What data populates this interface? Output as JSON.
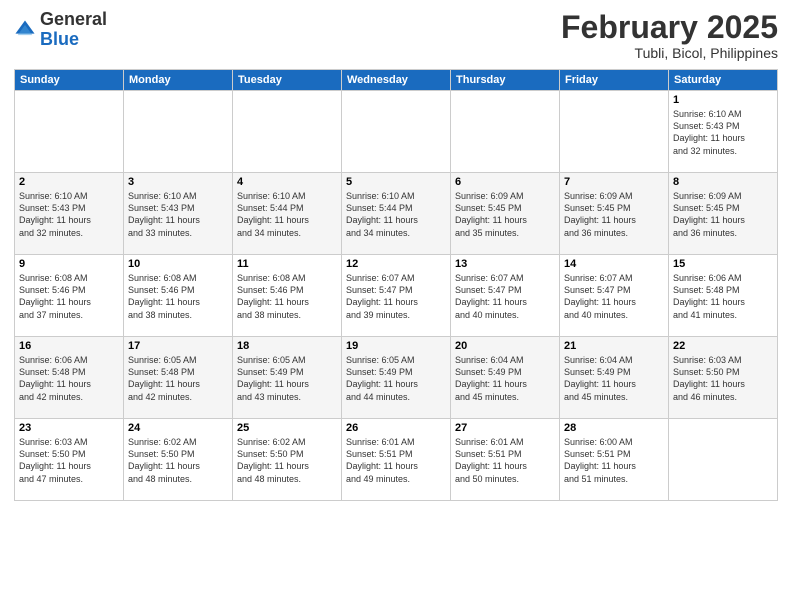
{
  "logo": {
    "general": "General",
    "blue": "Blue"
  },
  "title": {
    "month": "February 2025",
    "location": "Tubli, Bicol, Philippines"
  },
  "days_of_week": [
    "Sunday",
    "Monday",
    "Tuesday",
    "Wednesday",
    "Thursday",
    "Friday",
    "Saturday"
  ],
  "weeks": [
    [
      {
        "day": "",
        "info": ""
      },
      {
        "day": "",
        "info": ""
      },
      {
        "day": "",
        "info": ""
      },
      {
        "day": "",
        "info": ""
      },
      {
        "day": "",
        "info": ""
      },
      {
        "day": "",
        "info": ""
      },
      {
        "day": "1",
        "info": "Sunrise: 6:10 AM\nSunset: 5:43 PM\nDaylight: 11 hours\nand 32 minutes."
      }
    ],
    [
      {
        "day": "2",
        "info": "Sunrise: 6:10 AM\nSunset: 5:43 PM\nDaylight: 11 hours\nand 32 minutes."
      },
      {
        "day": "3",
        "info": "Sunrise: 6:10 AM\nSunset: 5:43 PM\nDaylight: 11 hours\nand 33 minutes."
      },
      {
        "day": "4",
        "info": "Sunrise: 6:10 AM\nSunset: 5:44 PM\nDaylight: 11 hours\nand 34 minutes."
      },
      {
        "day": "5",
        "info": "Sunrise: 6:10 AM\nSunset: 5:44 PM\nDaylight: 11 hours\nand 34 minutes."
      },
      {
        "day": "6",
        "info": "Sunrise: 6:09 AM\nSunset: 5:45 PM\nDaylight: 11 hours\nand 35 minutes."
      },
      {
        "day": "7",
        "info": "Sunrise: 6:09 AM\nSunset: 5:45 PM\nDaylight: 11 hours\nand 36 minutes."
      },
      {
        "day": "8",
        "info": "Sunrise: 6:09 AM\nSunset: 5:45 PM\nDaylight: 11 hours\nand 36 minutes."
      }
    ],
    [
      {
        "day": "9",
        "info": "Sunrise: 6:08 AM\nSunset: 5:46 PM\nDaylight: 11 hours\nand 37 minutes."
      },
      {
        "day": "10",
        "info": "Sunrise: 6:08 AM\nSunset: 5:46 PM\nDaylight: 11 hours\nand 38 minutes."
      },
      {
        "day": "11",
        "info": "Sunrise: 6:08 AM\nSunset: 5:46 PM\nDaylight: 11 hours\nand 38 minutes."
      },
      {
        "day": "12",
        "info": "Sunrise: 6:07 AM\nSunset: 5:47 PM\nDaylight: 11 hours\nand 39 minutes."
      },
      {
        "day": "13",
        "info": "Sunrise: 6:07 AM\nSunset: 5:47 PM\nDaylight: 11 hours\nand 40 minutes."
      },
      {
        "day": "14",
        "info": "Sunrise: 6:07 AM\nSunset: 5:47 PM\nDaylight: 11 hours\nand 40 minutes."
      },
      {
        "day": "15",
        "info": "Sunrise: 6:06 AM\nSunset: 5:48 PM\nDaylight: 11 hours\nand 41 minutes."
      }
    ],
    [
      {
        "day": "16",
        "info": "Sunrise: 6:06 AM\nSunset: 5:48 PM\nDaylight: 11 hours\nand 42 minutes."
      },
      {
        "day": "17",
        "info": "Sunrise: 6:05 AM\nSunset: 5:48 PM\nDaylight: 11 hours\nand 42 minutes."
      },
      {
        "day": "18",
        "info": "Sunrise: 6:05 AM\nSunset: 5:49 PM\nDaylight: 11 hours\nand 43 minutes."
      },
      {
        "day": "19",
        "info": "Sunrise: 6:05 AM\nSunset: 5:49 PM\nDaylight: 11 hours\nand 44 minutes."
      },
      {
        "day": "20",
        "info": "Sunrise: 6:04 AM\nSunset: 5:49 PM\nDaylight: 11 hours\nand 45 minutes."
      },
      {
        "day": "21",
        "info": "Sunrise: 6:04 AM\nSunset: 5:49 PM\nDaylight: 11 hours\nand 45 minutes."
      },
      {
        "day": "22",
        "info": "Sunrise: 6:03 AM\nSunset: 5:50 PM\nDaylight: 11 hours\nand 46 minutes."
      }
    ],
    [
      {
        "day": "23",
        "info": "Sunrise: 6:03 AM\nSunset: 5:50 PM\nDaylight: 11 hours\nand 47 minutes."
      },
      {
        "day": "24",
        "info": "Sunrise: 6:02 AM\nSunset: 5:50 PM\nDaylight: 11 hours\nand 48 minutes."
      },
      {
        "day": "25",
        "info": "Sunrise: 6:02 AM\nSunset: 5:50 PM\nDaylight: 11 hours\nand 48 minutes."
      },
      {
        "day": "26",
        "info": "Sunrise: 6:01 AM\nSunset: 5:51 PM\nDaylight: 11 hours\nand 49 minutes."
      },
      {
        "day": "27",
        "info": "Sunrise: 6:01 AM\nSunset: 5:51 PM\nDaylight: 11 hours\nand 50 minutes."
      },
      {
        "day": "28",
        "info": "Sunrise: 6:00 AM\nSunset: 5:51 PM\nDaylight: 11 hours\nand 51 minutes."
      },
      {
        "day": "",
        "info": ""
      }
    ]
  ]
}
